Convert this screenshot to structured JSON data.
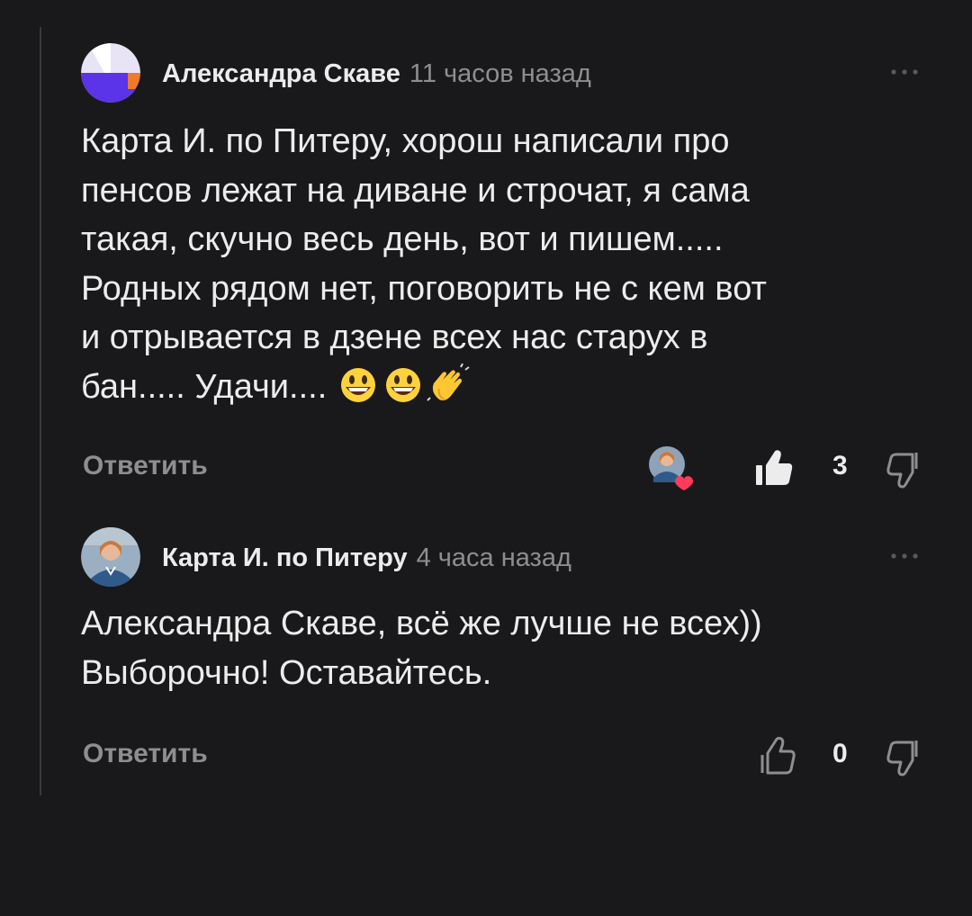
{
  "comments": [
    {
      "author": "Александра Скаве",
      "time": "11 часов назад",
      "body_lines": [
        "Карта И. по Питеру, хорош написали про",
        "пенсов лежат на диване и строчат, я сама",
        "такая, скучно весь день, вот и пишем.....",
        "Родных рядом нет, поговорить не с кем вот",
        "и отрывается в дзене всех нас старух в",
        "бан..... Удачи...."
      ],
      "emojis": [
        "smiley-emoji",
        "smiley-emoji",
        "clapping-hands-emoji"
      ],
      "reply_label": "Ответить",
      "likes": "3",
      "liked_by_author": true
    },
    {
      "author": "Карта И. по Питеру",
      "time": "4 часа назад",
      "body_lines": [
        "Александра Скаве, всё же лучше не всех))",
        "Выборочно! Оставайтесь."
      ],
      "reply_label": "Ответить",
      "likes": "0"
    }
  ],
  "colors": {
    "background": "#19191b",
    "text": "#ececec",
    "muted": "#8e8e92",
    "thread_line": "#3a3a3d"
  }
}
